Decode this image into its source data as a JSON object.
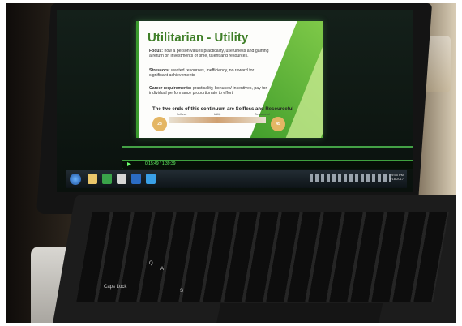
{
  "slide": {
    "title": "Utilitarian - Utility",
    "focus_label": "Focus:",
    "focus_text": "how a person values practicality, usefulness and gaining a return on investments of time, talent and resources.",
    "stressors_label": "Stressors:",
    "stressors_text": "wasted resources, inefficiency, no reward for significant achievements",
    "career_label": "Career requirements:",
    "career_text": "practicality, bonuses/ incentives, pay for individual performance proportionate to effort",
    "continuum_text": "The two ends of this continuum are Selfless and Resourceful",
    "scale_left": "Selfless",
    "scale_mid": "Utility",
    "scale_right": "Resourceful",
    "circle_left": "28",
    "circle_right": "45"
  },
  "player": {
    "time": "0:15:49 / 1:39:39"
  },
  "taskbar": {
    "clock_time": "9:55 PM",
    "clock_date": "7/18/2017"
  },
  "keyboard": {
    "caps_label": "Caps Lock",
    "key_a": "A",
    "key_s": "S",
    "key_q": "Q"
  },
  "colors": {
    "slide_accent": "#3f7f28",
    "player_accent": "#6bff6b",
    "scale_accent": "#e4b664"
  }
}
